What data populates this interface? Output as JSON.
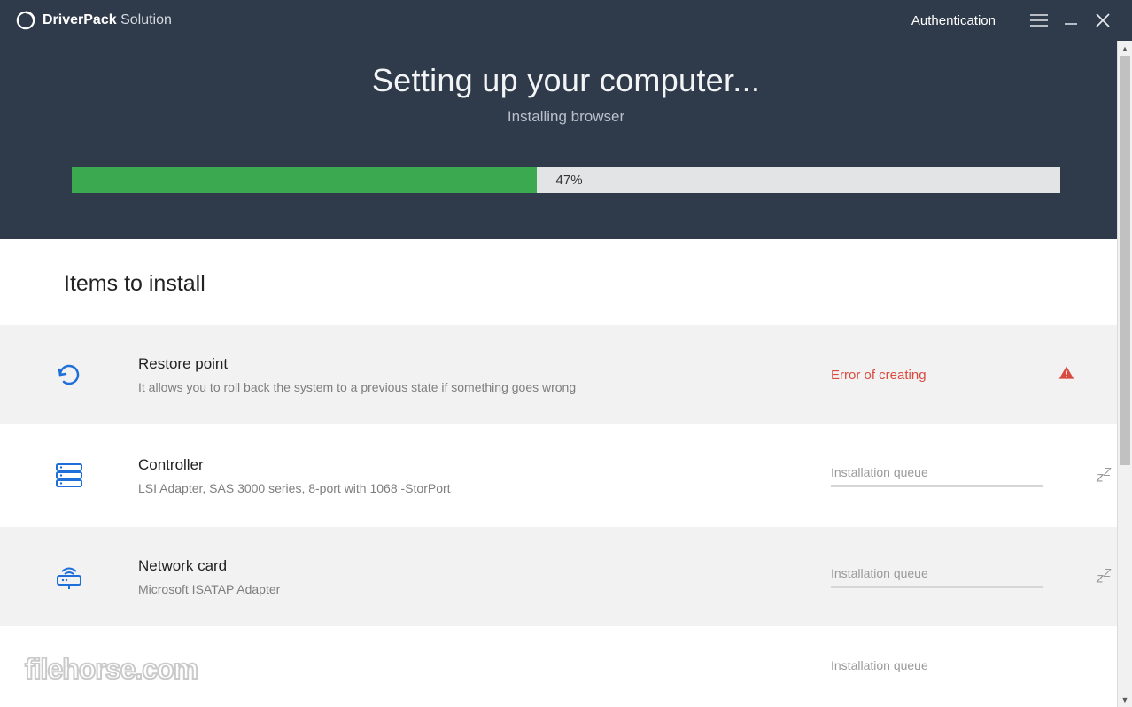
{
  "titlebar": {
    "brand_strong": "DriverPack",
    "brand_light": " Solution",
    "auth": "Authentication"
  },
  "header": {
    "title": "Setting up your computer...",
    "subtitle": "Installing browser"
  },
  "progress": {
    "percent": 47,
    "label": "47%"
  },
  "section_title": "Items to install",
  "items": [
    {
      "title": "Restore point",
      "desc": "It allows you to roll back the system to a previous state if something goes wrong",
      "status_type": "error",
      "status_text": "Error of creating"
    },
    {
      "title": "Controller",
      "desc": "LSI Adapter, SAS 3000 series, 8-port with 1068 -StorPort",
      "status_type": "queue",
      "status_text": "Installation queue"
    },
    {
      "title": "Network card",
      "desc": "Microsoft ISATAP Adapter",
      "status_type": "queue",
      "status_text": "Installation queue"
    },
    {
      "title": "",
      "desc": "",
      "status_type": "queue",
      "status_text": "Installation queue"
    }
  ],
  "watermark": "filehorse.com"
}
